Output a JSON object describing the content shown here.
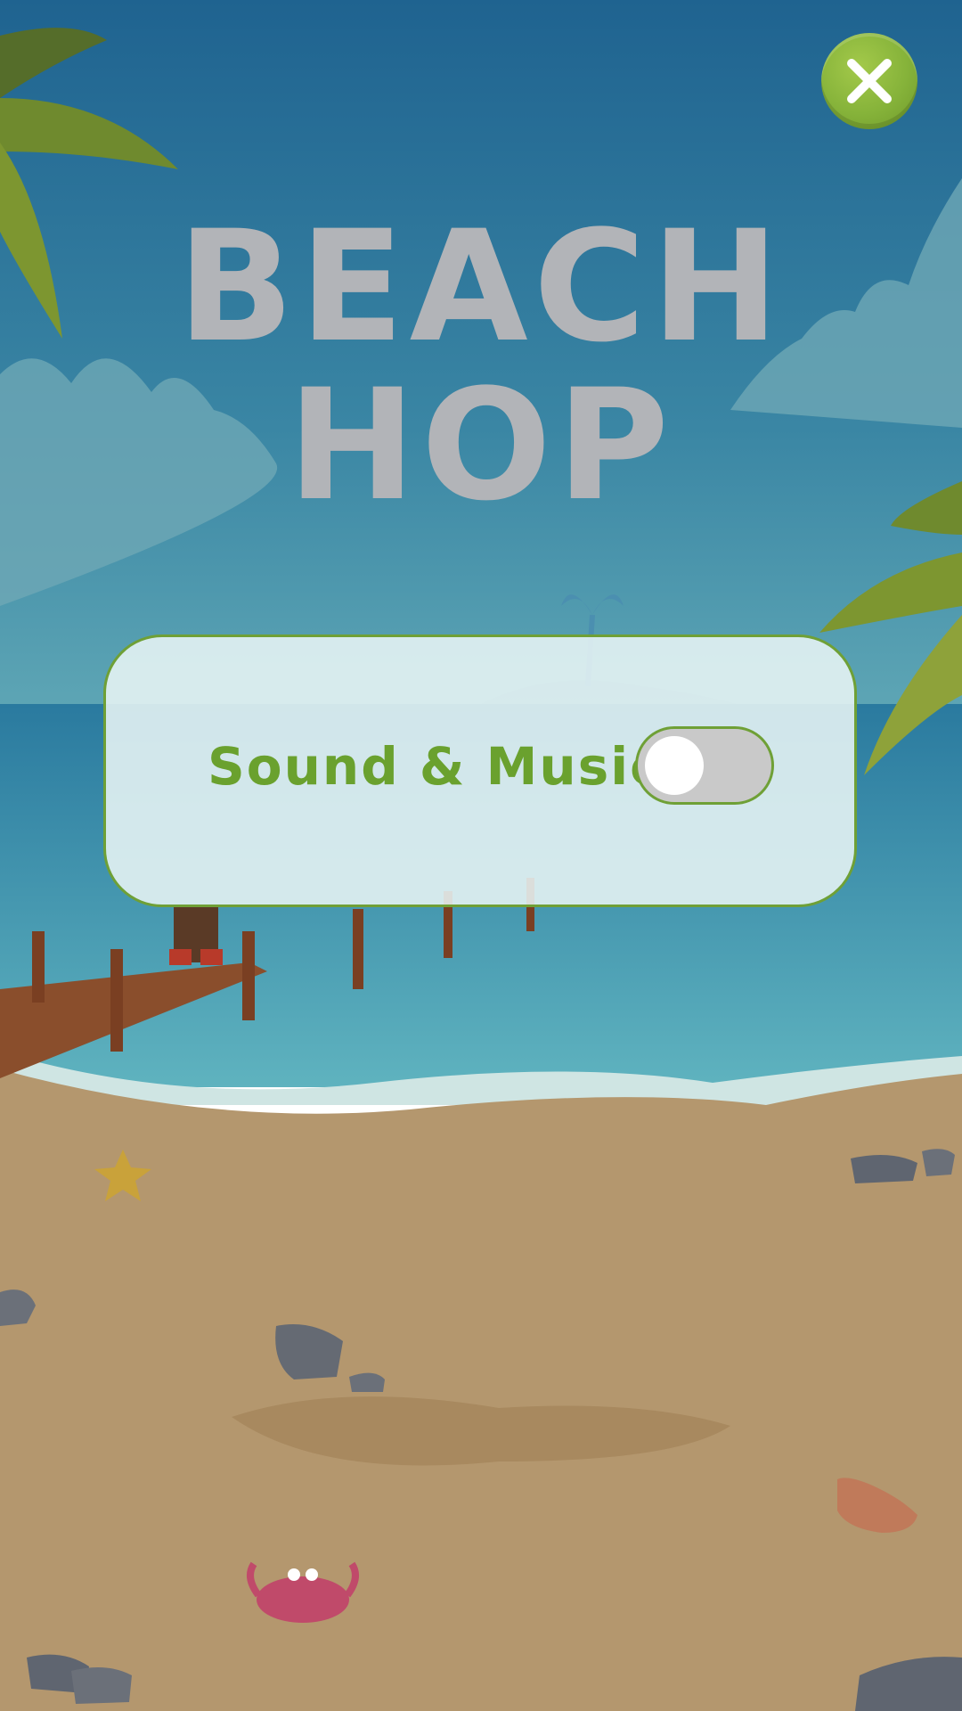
{
  "title": {
    "line1": "BEACH",
    "line2": "HOP"
  },
  "settings": {
    "sound_music": {
      "label": "Sound & Music",
      "enabled": false
    }
  },
  "icons": {
    "close": "close-icon"
  },
  "colors": {
    "accent_green": "#6fa036",
    "label_green": "#6aa12e",
    "title_gray": "#b2b4b8",
    "sky": "#2a6f95",
    "sea": "#3a8fae",
    "sand": "#b4976e"
  }
}
